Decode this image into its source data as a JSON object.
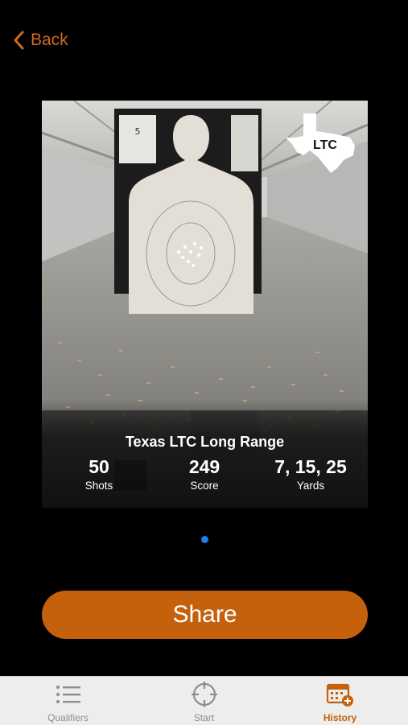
{
  "nav": {
    "back_label": "Back"
  },
  "card": {
    "badge_text": "LTC",
    "target_number": "5",
    "title": "Texas LTC Long Range",
    "stats": [
      {
        "value": "50",
        "label": "Shots"
      },
      {
        "value": "249",
        "label": "Score"
      },
      {
        "value": "7, 15, 25",
        "label": "Yards"
      }
    ]
  },
  "pager": {
    "current": 1,
    "total": 1
  },
  "share_label": "Share",
  "tabs": [
    {
      "label": "Qualifiers",
      "icon": "list-icon",
      "active": false
    },
    {
      "label": "Start",
      "icon": "crosshair-icon",
      "active": false
    },
    {
      "label": "History",
      "icon": "calendar-add-icon",
      "active": true
    }
  ],
  "colors": {
    "accent": "#c5600c",
    "back": "#d06a1c",
    "dot": "#1a7ff0",
    "tab_inactive": "#8e8e8e"
  }
}
